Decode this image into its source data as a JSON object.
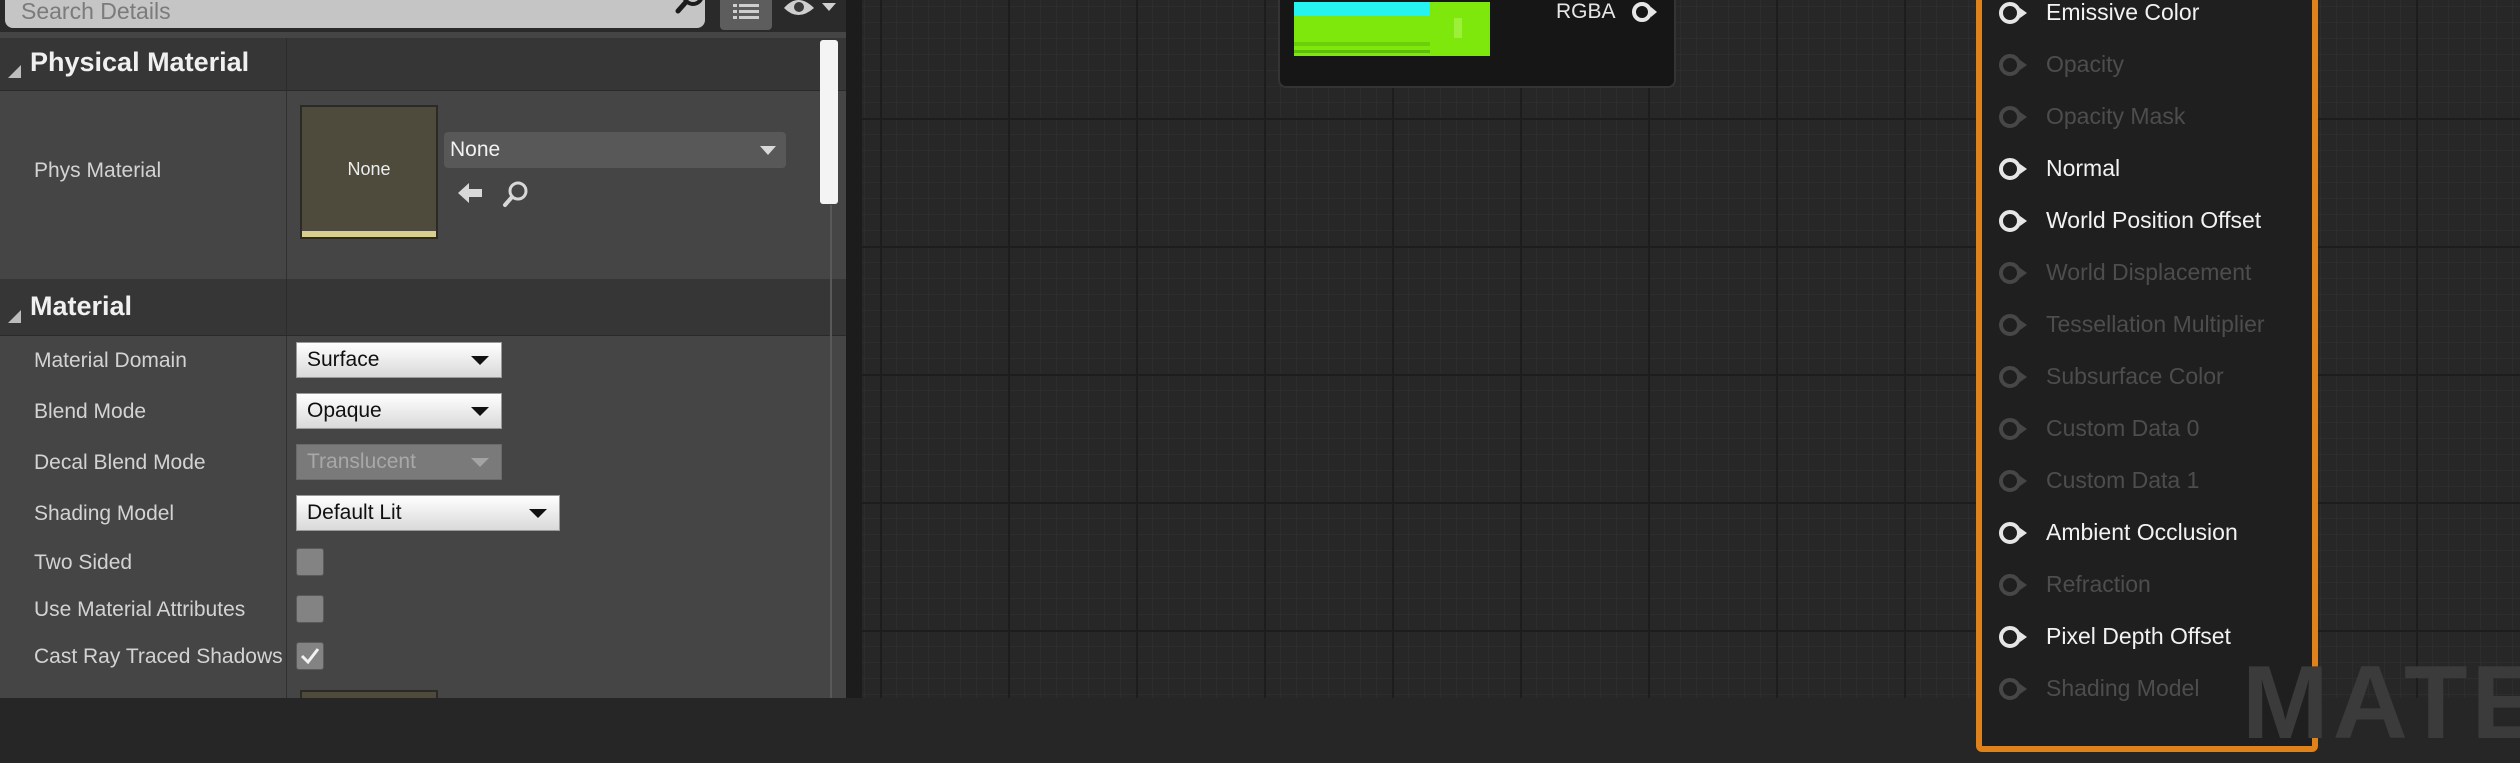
{
  "details_panel": {
    "search": {
      "placeholder": "Search Details"
    },
    "sections": {
      "physical_material": {
        "title": "Physical Material",
        "phys_material": {
          "label": "Phys Material",
          "thumbnail_text": "None",
          "value": "None"
        }
      },
      "material": {
        "title": "Material",
        "properties": {
          "material_domain": {
            "label": "Material Domain",
            "value": "Surface"
          },
          "blend_mode": {
            "label": "Blend Mode",
            "value": "Opaque"
          },
          "decal_blend_mode": {
            "label": "Decal Blend Mode",
            "value": "Translucent",
            "enabled": false
          },
          "shading_model": {
            "label": "Shading Model",
            "value": "Default Lit"
          },
          "two_sided": {
            "label": "Two Sided",
            "checked": false
          },
          "use_material_attributes": {
            "label": "Use Material Attributes",
            "checked": false
          },
          "cast_ray_traced_shadows": {
            "label": "Cast Ray Traced Shadows",
            "checked": true
          }
        }
      }
    }
  },
  "graph": {
    "texture_node": {
      "output_label": "RGBA"
    },
    "result_node": {
      "accent_color": "#e0821b",
      "pins": [
        {
          "label": "Emissive Color",
          "enabled": true
        },
        {
          "label": "Opacity",
          "enabled": false
        },
        {
          "label": "Opacity Mask",
          "enabled": false
        },
        {
          "label": "Normal",
          "enabled": true
        },
        {
          "label": "World Position Offset",
          "enabled": true
        },
        {
          "label": "World Displacement",
          "enabled": false
        },
        {
          "label": "Tessellation Multiplier",
          "enabled": false
        },
        {
          "label": "Subsurface Color",
          "enabled": false
        },
        {
          "label": "Custom Data 0",
          "enabled": false
        },
        {
          "label": "Custom Data 1",
          "enabled": false
        },
        {
          "label": "Ambient Occlusion",
          "enabled": true
        },
        {
          "label": "Refraction",
          "enabled": false
        },
        {
          "label": "Pixel Depth Offset",
          "enabled": true
        },
        {
          "label": "Shading Model",
          "enabled": false
        }
      ]
    },
    "watermark": "MATE"
  }
}
